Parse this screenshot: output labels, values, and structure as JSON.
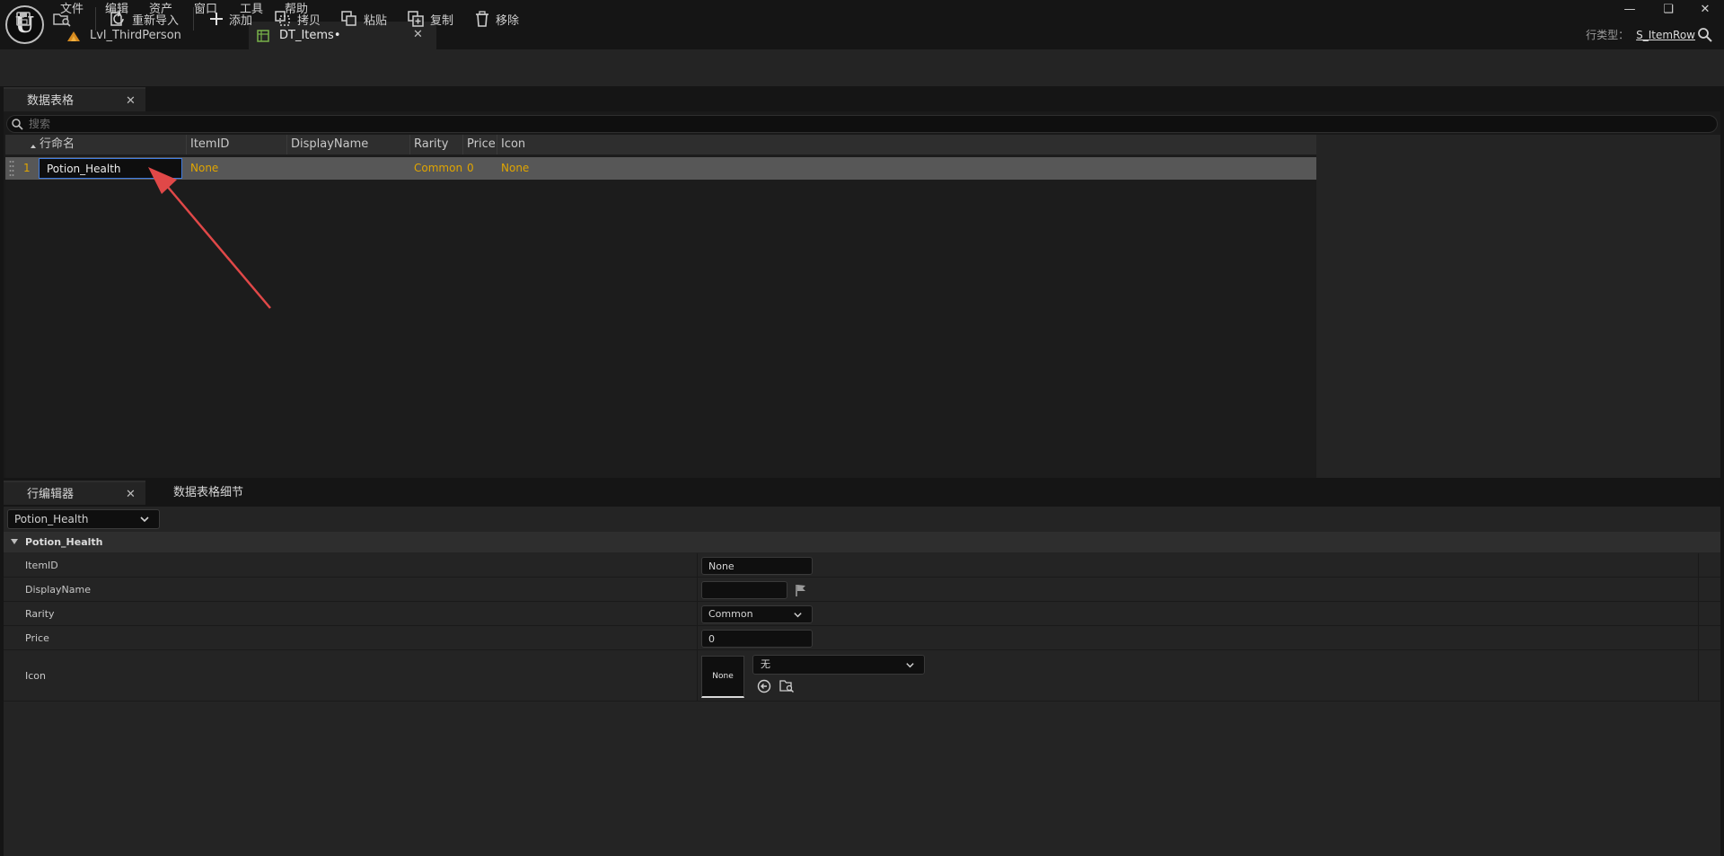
{
  "menu": [
    "文件",
    "编辑",
    "资产",
    "窗口",
    "工具",
    "帮助"
  ],
  "tabs": {
    "level": "Lvl_ThirdPerson",
    "datatable": "DT_Items•"
  },
  "row_type": {
    "label": "行类型：",
    "value": "S_ItemRow"
  },
  "toolbar": {
    "reimport": "重新导入",
    "add": "添加",
    "copy": "拷贝",
    "paste": "粘贴",
    "duplicate": "复制",
    "remove": "移除"
  },
  "data_table_panel": {
    "tab_label": "数据表格",
    "search_placeholder": "搜索",
    "columns": [
      "行命名",
      "ItemID",
      "DisplayName",
      "Rarity",
      "Price",
      "Icon"
    ],
    "rows": [
      {
        "index": "1",
        "name": "Potion_Health",
        "ItemID": "None",
        "DisplayName": "",
        "Rarity": "Common",
        "Price": "0",
        "Icon": "None"
      }
    ]
  },
  "row_editor": {
    "tab_label": "行编辑器",
    "details_tab_label": "数据表格细节",
    "selected_row": "Potion_Health",
    "section_title": "Potion_Health",
    "properties": [
      {
        "label": "ItemID",
        "value": "None"
      },
      {
        "label": "DisplayName",
        "value": ""
      },
      {
        "label": "Rarity",
        "value": "Common"
      },
      {
        "label": "Price",
        "value": "0"
      },
      {
        "label": "Icon",
        "thumb": "None",
        "combo": "无"
      }
    ]
  },
  "colors": {
    "accent_text": "#e0a500",
    "selection_border": "#3f7be0",
    "annotation_arrow": "#e04848"
  }
}
